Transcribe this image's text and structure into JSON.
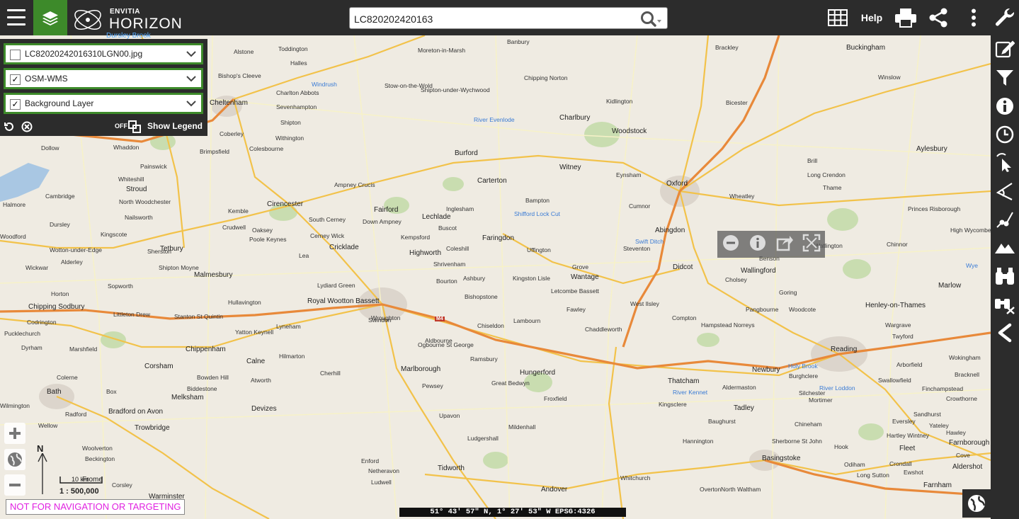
{
  "header": {
    "logo_small": "ENVITIA",
    "logo_big": "HORIZON",
    "logo_cut": "Dursley Brook",
    "search_value": "LC820202420163",
    "help_label": "Help"
  },
  "layers": [
    {
      "name": "LC82020242016310LGN00.jpg",
      "checked": false,
      "check_mark": ""
    },
    {
      "name": "OSM-WMS",
      "checked": true,
      "check_mark": "✓"
    },
    {
      "name": "Background Layer",
      "checked": true,
      "check_mark": "✓"
    }
  ],
  "legend": {
    "toggle_state": "OFF",
    "label": "Show Legend"
  },
  "map": {
    "north_label": "N",
    "scale_unit": "10 km",
    "scale_text": "1 : 500,000",
    "warning": "NOT FOR NAVIGATION OR TARGETING",
    "coordinates": "51° 43' 57\" N,   1° 27' 53\" W   EPSG:4326",
    "road_label": "M4",
    "places": {
      "p1": "Alstone",
      "p2": "Toddington",
      "p3": "Halles",
      "p4": "Bishop's Cleeve",
      "p5": "Cheltenham",
      "p6": "Charlton Abbots",
      "p7": "Sevenhampton",
      "p8": "Shipton",
      "p9": "Withington",
      "p10": "Colesbourne",
      "p11": "Coberley",
      "p12": "Brimpsfield",
      "p13": "Whaddon",
      "p14": "Dollow",
      "p15": "Painswick",
      "p16": "Whiteshill",
      "p17": "Stroud",
      "p18": "Cambridge",
      "p19": "Halmore",
      "p20": "Woodford",
      "p21": "Dursley",
      "p22": "Kingscote",
      "p23": "Nailsworth",
      "p24": "North Woodchester",
      "p25": "Tetbury",
      "p26": "Wotton-under-Edge",
      "p27": "Alderley",
      "p28": "Wickwar",
      "p29": "Horton",
      "p30": "Sopworth",
      "p31": "Chipping Sodbury",
      "p32": "Codrington",
      "p33": "Pucklechurch",
      "p34": "Dyrham",
      "p35": "Marshfield",
      "p36": "Bath",
      "p37": "Wilmington",
      "p38": "Wellow",
      "p39": "Radford",
      "p40": "Bradford on Avon",
      "p41": "Trowbridge",
      "p42": "Woolverton",
      "p43": "Beckington",
      "p44": "Frome",
      "p45": "Corsley",
      "p46": "Warminster",
      "p47": "Sherston",
      "p48": "Malmesbury",
      "p49": "Shipton Moyne",
      "p50": "Littleton Drew",
      "p51": "Stanton St Quintin",
      "p52": "Chippenham",
      "p53": "Corsham",
      "p54": "Melksham",
      "p55": "Devizes",
      "p56": "Calne",
      "p57": "Royal Wootton Bassett",
      "p58": "Lydiard Green",
      "p59": "Cricklade",
      "p60": "Cirencester",
      "p61": "Ampney Crucis",
      "p62": "Fairford",
      "p63": "Lechlade",
      "p64": "Buscot",
      "p65": "Highworth",
      "p66": "Faringdon",
      "p67": "Witney",
      "p68": "Carterton",
      "p69": "Burford",
      "p70": "Shipton-under-Wychwood",
      "p71": "Charlbury",
      "p72": "Woodstock",
      "p73": "Kidlington",
      "p74": "Oxford",
      "p75": "Abingdon",
      "p76": "Didcot",
      "p77": "Wantage",
      "p78": "Wallingford",
      "p79": "Thame",
      "p80": "Bicester",
      "p81": "Aylesbury",
      "p82": "Buckingham",
      "p83": "Winslow",
      "p84": "Henley-on-Thames",
      "p85": "Marlow",
      "p86": "Reading",
      "p87": "Wokingham",
      "p88": "Bracknell",
      "p89": "Newbury",
      "p90": "Thatcham",
      "p91": "Hungerford",
      "p92": "Marlborough",
      "p93": "Swindon",
      "p94": "Basingstoke",
      "p95": "Andover",
      "p96": "Whitchurch",
      "p97": "Tidworth",
      "p98": "Ludgershall",
      "p99": "Stow-on-the-Wold",
      "p100": "Moreton-in-Marsh",
      "p101": "Chipping Norton",
      "p102": "Banbury",
      "p103": "Brackley",
      "p104": "Lambourn",
      "p105": "Kingston Lisle",
      "p106": "Compton",
      "p107": "Pangbourne",
      "p108": "Tadley",
      "p109": "Kingsclere",
      "p110": "Burghclere",
      "p111": "Hook",
      "p112": "Odiham",
      "p113": "Fleet",
      "p114": "Farnborough",
      "p115": "Aldershot",
      "p116": "Farnham",
      "p117": "Hartley Wintney",
      "p118": "Crowthorne",
      "p119": "Sandhurst",
      "p120": "Twyford",
      "p121": "Wargrave",
      "p122": "Woodcote",
      "p123": "Goring",
      "p124": "Cholsey",
      "p125": "Benson",
      "p126": "Watlington",
      "p127": "Chinnor",
      "p128": "Princes Risborough",
      "p129": "High Wycombe",
      "p130": "Brill",
      "p131": "Long Crendon",
      "p132": "Wheatley",
      "p133": "Bampton",
      "p134": "Eynsham",
      "p135": "Cumnor",
      "p136": "Steventon",
      "p137": "Grove",
      "p138": "Shrivenham",
      "p139": "Ashbury",
      "p140": "Aldbourne",
      "p141": "Ramsbury",
      "p142": "Froxfield",
      "p143": "Great Bedwyn",
      "p144": "Pewsey",
      "p145": "Upavon",
      "p146": "Enford",
      "p147": "Netheravon",
      "p148": "Ludwell",
      "p149": "Mildenhall",
      "p150": "Ogbourne St George",
      "p151": "Chiseldon",
      "p152": "Wroughton",
      "p153": "Lyneham",
      "p154": "Hilmarton",
      "p155": "Cherhill",
      "p156": "Bowden Hill",
      "p157": "Atworth",
      "p158": "Box",
      "p159": "Colerne",
      "p160": "Biddestone",
      "p161": "Yatton Keynell",
      "p162": "Hullavington",
      "p163": "Lea",
      "p164": "Crudwell",
      "p165": "Oaksey",
      "p166": "Kemble",
      "p167": "Poole Keynes",
      "p168": "Cerney Wick",
      "p169": "South Cerney",
      "p170": "Down Ampney",
      "p171": "Kempsford",
      "p172": "Inglesham",
      "p173": "Coleshill",
      "p174": "Bourton",
      "p175": "Bishopstone",
      "p176": "Uffington",
      "p177": "Letcombe Bassett",
      "p178": "Fawley",
      "p179": "Chaddleworth",
      "p180": "West Ilsley",
      "p181": "Hampstead Norreys",
      "p182": "Aldermaston",
      "p183": "Baughurst",
      "p184": "Hannington",
      "p185": "Overton",
      "p186": "Sherborne St John",
      "p187": "Chineham",
      "p188": "Silchester",
      "p189": "Mortimer",
      "p190": "Swallowfield",
      "p191": "Arborfield",
      "p192": "Finchampstead",
      "p193": "Eversley",
      "p194": "Yateley",
      "p195": "Hawley",
      "p196": "Cove",
      "p197": "Crondall",
      "p198": "Ewshot",
      "p199": "Long Sutton",
      "p200": "North Waltham"
    },
    "water": {
      "w1": "Windrush",
      "w2": "River Evenlode",
      "w3": "Shifford Lock Cut",
      "w4": "Swift Ditch",
      "w5": "Holy Brook",
      "w6": "River Loddon",
      "w7": "River Kennet",
      "w8": "Wye"
    }
  }
}
